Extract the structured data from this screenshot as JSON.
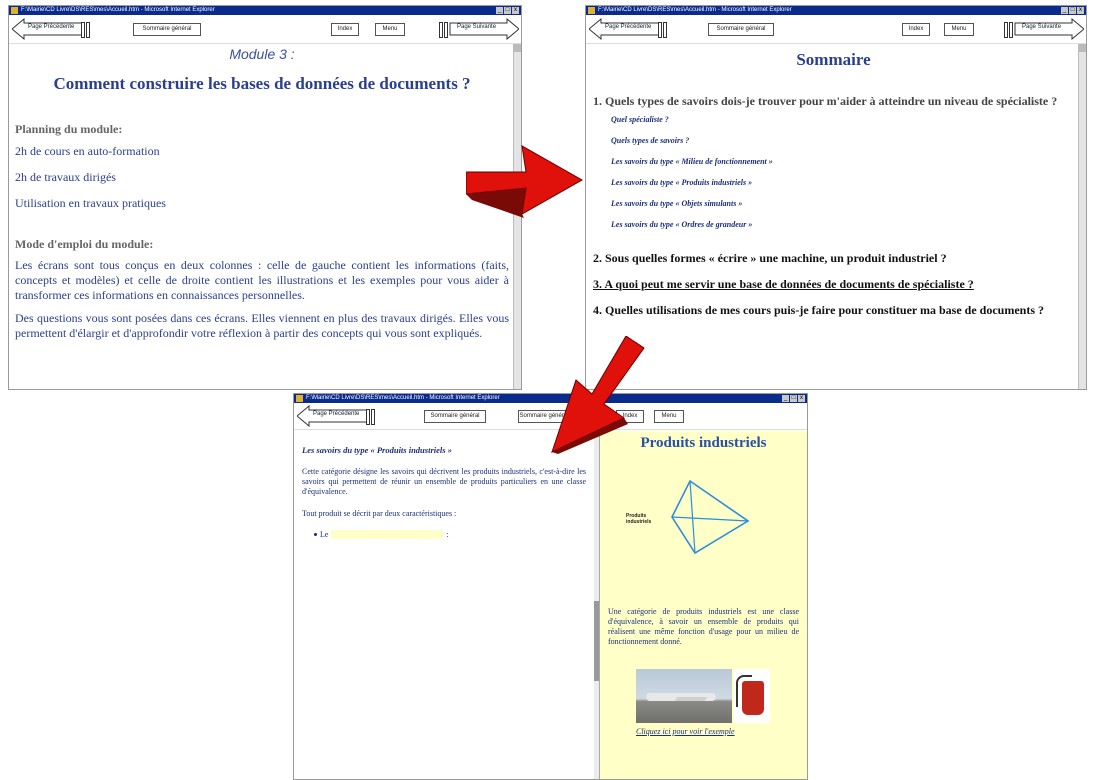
{
  "common": {
    "window_title": "F:\\Mairie\\CD Livre\\DS\\RES\\mes\\Accueil.htm - Microsoft Internet Explorer",
    "prev_label": "Page Précédente",
    "next_label": "Page Suivante",
    "summary_label": "Sommaire général",
    "index_label": "Index",
    "menu_label": "Menu",
    "ctrl_min": "_",
    "ctrl_max": "□",
    "ctrl_close": "x"
  },
  "win1": {
    "module": "Module 3 :",
    "title": "Comment construire les bases de données de documents ?",
    "planning_heading": "Planning du module:",
    "planning_items": [
      "2h de cours en auto-formation",
      "2h de travaux dirigés",
      "Utilisation en travaux pratiques"
    ],
    "mode_heading": "Mode d'emploi du module:",
    "mode_p1": "Les écrans sont tous conçus en deux colonnes : celle de gauche contient les informations (faits, concepts et modèles) et celle de droite contient les illustrations et les exemples pour vous aider à transformer ces informations en connaissances personnelles.",
    "mode_p2": "Des questions vous sont posées dans ces écrans. Elles viennent en plus des travaux dirigés. Elles vous permettent d'élargir et d'approfondir votre réflexion à partir des concepts qui vous sont expliqués."
  },
  "win2": {
    "title": "Sommaire",
    "q1": "1. Quels types de savoirs dois-je trouver pour m'aider à atteindre un niveau de spécialiste ?",
    "links": [
      "Quel spécialiste ?",
      "Quels types de savoirs ?",
      "Les savoirs du type « Milieu de fonctionnement »",
      "Les savoirs du type « Produits industriels »",
      "Les savoirs du type « Objets simulants »",
      "Les savoirs du type « Ordres de grandeur »"
    ],
    "q2": "2. Sous quelles formes « écrire » une machine, un produit industriel ?",
    "q3": "3. A quoi peut me servir une base de données de documents de spécialiste ?",
    "q4": "4. Quelles utilisations de mes cours puis-je faire pour constituer ma base de documents ?"
  },
  "win3": {
    "left_title": "Les savoirs du type « Produits industriels »",
    "left_p1": "Cette catégorie désigne les savoirs qui décrivent les produits industriels, c'est-à-dire les savoirs qui permettent de réunir un ensemble de produits particuliers en une classe d'équivalence.",
    "left_p2": "Tout produit se décrit par deux caractéristiques :",
    "bullet_prefix": "Le",
    "bullet_suffix": ":",
    "right_title": "Produits industriels",
    "diagram_label": "Produits industriels",
    "right_p": "Une catégorie de produits industriels est une classe d'équivalence, à savoir un ensemble de produits qui réalisent une même fonction d'usage pour un milieu de fonctionnement donné.",
    "right_link": "Cliquez ici pour voir l'exemple"
  },
  "colors": {
    "titlebar": "#0a2a8c",
    "heading_blue": "#2a3f8f",
    "arrow_red": "#e0100a",
    "panel_yellow": "#ffffc8"
  }
}
